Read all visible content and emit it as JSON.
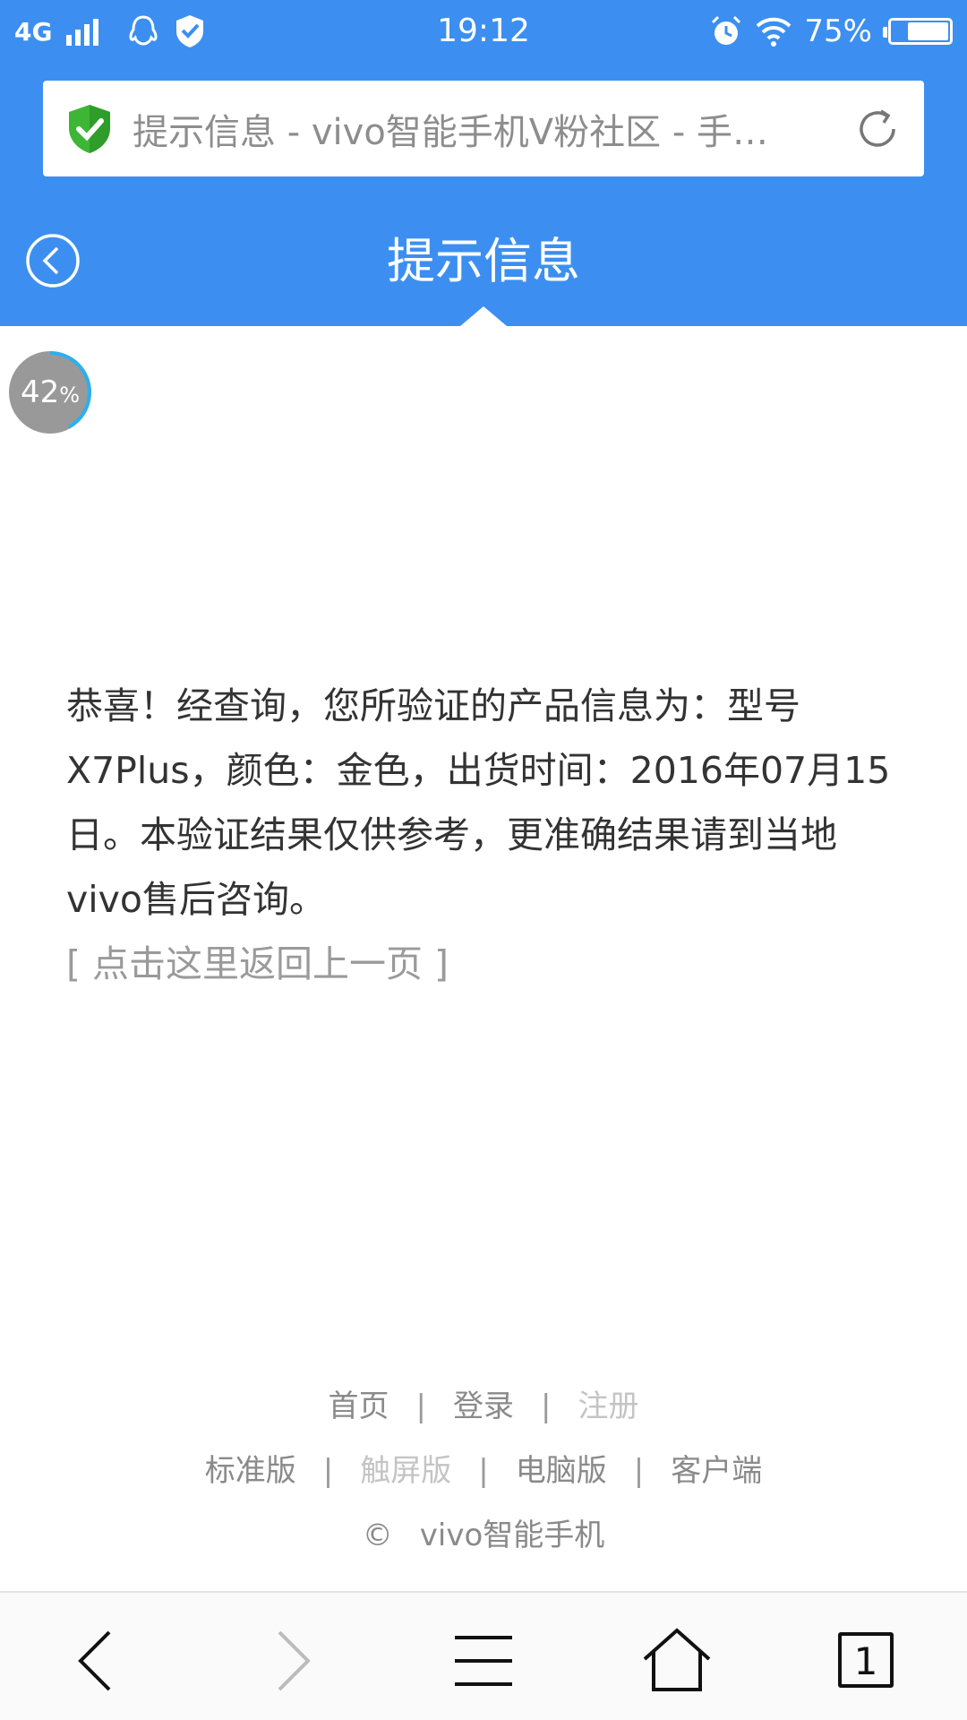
{
  "status_bar": {
    "network": "4G",
    "time": "19:12",
    "battery": "75%",
    "battery_level": 0.75
  },
  "url_bar": {
    "title": "提示信息 - vivo智能手机V粉社区 - 手…"
  },
  "header": {
    "title": "提示信息"
  },
  "progress": {
    "value": "42",
    "unit": "%",
    "fraction": 0.42
  },
  "content": {
    "message": "恭喜！经查询，您所验证的产品信息为：型号X7Plus，颜色：金色，出货时间：2016年07月15日。本验证结果仅供参考，更准确结果请到当地vivo售后咨询。",
    "back_link": "[ 点击这里返回上一页 ]"
  },
  "footer": {
    "row1": [
      "首页",
      "登录",
      "注册"
    ],
    "row2": [
      "标准版",
      "触屏版",
      "电脑版",
      "客户端"
    ],
    "copyright_symbol": "©",
    "copyright_text": "vivo智能手机"
  },
  "bottom_nav": {
    "tab_count": "1"
  }
}
